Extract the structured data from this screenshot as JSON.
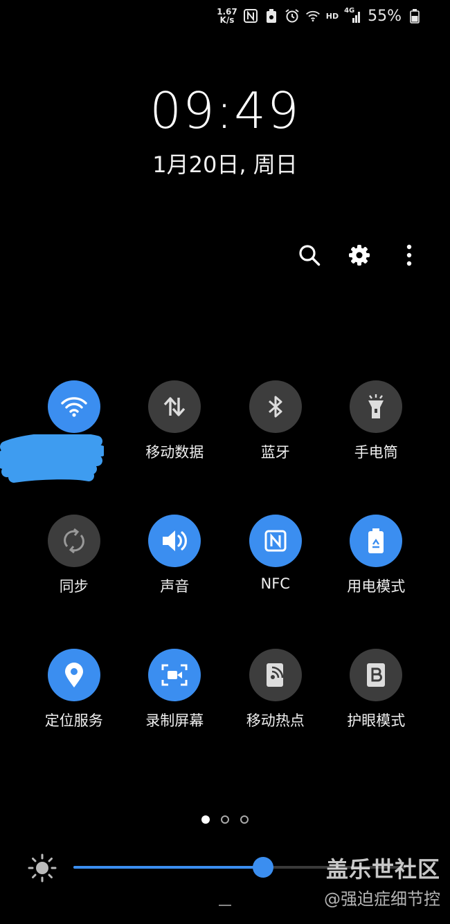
{
  "status_bar": {
    "net_speed_value": "1.67",
    "net_speed_unit": "K/s",
    "icons": [
      "nfc-icon",
      "battery-saver-icon",
      "alarm-icon",
      "wifi-icon",
      "hd-icon",
      "signal-4g-icon",
      "battery-icon"
    ],
    "hd_label": "HD",
    "network_label": "4G",
    "battery_percent": "55%"
  },
  "clock": {
    "time": "09:49",
    "date": "1月20日, 周日"
  },
  "actions": [
    "search-icon",
    "settings-icon",
    "more-icon"
  ],
  "tiles": [
    {
      "id": "wifi",
      "label": "",
      "icon": "wifi-icon",
      "active": true
    },
    {
      "id": "mobile-data",
      "label": "移动数据",
      "icon": "data-arrows-icon",
      "active": false
    },
    {
      "id": "bluetooth",
      "label": "蓝牙",
      "icon": "bluetooth-icon",
      "active": false
    },
    {
      "id": "flashlight",
      "label": "手电筒",
      "icon": "flashlight-icon",
      "active": false
    },
    {
      "id": "sync",
      "label": "同步",
      "icon": "sync-icon",
      "active": false
    },
    {
      "id": "sound",
      "label": "声音",
      "icon": "volume-icon",
      "active": true
    },
    {
      "id": "nfc",
      "label": "NFC",
      "icon": "nfc-icon",
      "active": true
    },
    {
      "id": "power-mode",
      "label": "用电模式",
      "icon": "battery-recycle-icon",
      "active": true
    },
    {
      "id": "location",
      "label": "定位服务",
      "icon": "location-pin-icon",
      "active": true
    },
    {
      "id": "screen-record",
      "label": "录制屏幕",
      "icon": "screen-record-icon",
      "active": true
    },
    {
      "id": "hotspot",
      "label": "移动热点",
      "icon": "hotspot-icon",
      "active": false
    },
    {
      "id": "eye-comfort",
      "label": "护眼模式",
      "icon": "eye-comfort-icon",
      "active": false
    }
  ],
  "pagination": {
    "pages": 3,
    "current": 1
  },
  "brightness": {
    "level_fraction": 0.57
  },
  "colors": {
    "accent": "#3b8ef0",
    "tile_off": "#3d3d3d",
    "background": "#000000"
  },
  "watermark": {
    "title": "盖乐世社区",
    "subtitle": "@强迫症细节控"
  }
}
